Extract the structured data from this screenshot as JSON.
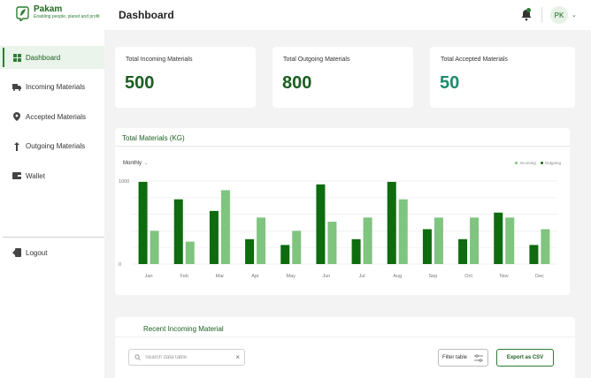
{
  "brand": {
    "name": "Pakam",
    "tagline": "Enabling people, planet and profit"
  },
  "header": {
    "title": "Dashboard",
    "notifications_icon": "bell-icon",
    "avatar_initials": "PK"
  },
  "sidebar": {
    "items": [
      {
        "label": "Dashboard",
        "icon": "grid-icon",
        "active": true
      },
      {
        "label": "Incoming Materials",
        "icon": "truck-icon"
      },
      {
        "label": "Accepted Materials",
        "icon": "location-pin-icon"
      },
      {
        "label": "Outgoing Materials",
        "icon": "arrow-up-icon"
      },
      {
        "label": "Wallet",
        "icon": "wallet-icon"
      }
    ],
    "logout_label": "Logout"
  },
  "stats": [
    {
      "label": "Total Incoming Materials",
      "value": "500",
      "color": "#1b5e20"
    },
    {
      "label": "Total Outgoing Materials",
      "value": "800",
      "color": "#1b5e20"
    },
    {
      "label": "Total Accepted Materials",
      "value": "50",
      "color": "#1e8a6e"
    }
  ],
  "chart": {
    "title": "Total Materials (KG)",
    "period": "Monthly",
    "colors": {
      "incoming": "#7fc47f",
      "outgoing": "#0e6b0e"
    }
  },
  "chart_data": {
    "type": "bar",
    "categories": [
      "Jan",
      "Feb",
      "Mar",
      "Apr",
      "May",
      "Jun",
      "Jul",
      "Aug",
      "Sep",
      "Oct",
      "Nov",
      "Dec"
    ],
    "series": [
      {
        "name": "Incoming",
        "values": [
          400,
          270,
          890,
          560,
          400,
          510,
          560,
          780,
          560,
          560,
          560,
          420
        ]
      },
      {
        "name": "Outgoing",
        "values": [
          990,
          780,
          640,
          300,
          230,
          960,
          300,
          990,
          420,
          300,
          620,
          230
        ]
      }
    ],
    "ylim": [
      0,
      1000
    ],
    "yticks": [
      0,
      1000
    ],
    "grid": true,
    "legend": "top-right"
  },
  "recent": {
    "title": "Recent Incoming  Material",
    "search_placeholder": "Search data table",
    "filter_label": "Filter table",
    "export_label": "Export as CSV"
  }
}
